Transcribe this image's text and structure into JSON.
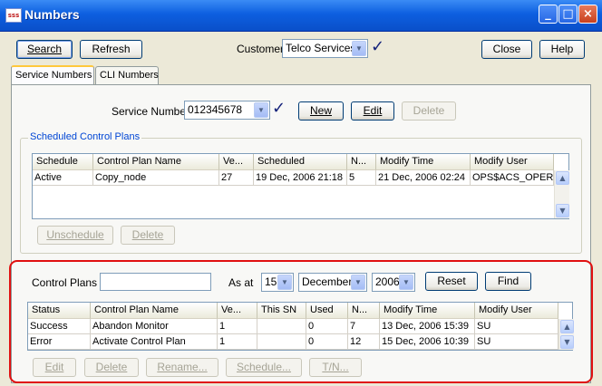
{
  "window": {
    "title": "Numbers",
    "app_icon": "sss",
    "minimize": "_",
    "maximize": "□",
    "close": "×"
  },
  "toolbar": {
    "search": "Search",
    "refresh": "Refresh",
    "customer_label": "Customer",
    "customer_value": "Telco Services",
    "close": "Close",
    "help": "Help"
  },
  "tabs": [
    {
      "label": "Service Numbers"
    },
    {
      "label": "CLI Numbers"
    }
  ],
  "service": {
    "label": "Service Number",
    "value": "012345678",
    "new": "New",
    "edit": "Edit",
    "delete": "Delete"
  },
  "scheduled": {
    "title": "Scheduled Control Plans",
    "columns": [
      "Schedule",
      "Control Plan Name",
      "Ve...",
      "Scheduled",
      "N...",
      "Modify Time",
      "Modify User"
    ],
    "rows": [
      [
        "Active",
        "Copy_node",
        "27",
        "19 Dec, 2006 21:18",
        "5",
        "21 Dec, 2006 02:24",
        "OPS$ACS_OPER"
      ]
    ],
    "unschedule": "Unschedule",
    "delete": "Delete"
  },
  "plans": {
    "label": "Control Plans",
    "filter_value": "",
    "as_at_label": "As at",
    "day": "15",
    "month": "December",
    "year": "2006",
    "reset": "Reset",
    "find": "Find",
    "columns": [
      "Status",
      "Control Plan Name",
      "Ve...",
      "This SN",
      "Used",
      "N...",
      "Modify Time",
      "Modify User"
    ],
    "rows": [
      [
        "Success",
        "Abandon Monitor",
        "1",
        "",
        "0",
        "7",
        "13 Dec, 2006 15:39",
        "SU"
      ],
      [
        "Error",
        "Activate Control Plan",
        "1",
        "",
        "0",
        "12",
        "15 Dec, 2006 10:39",
        "SU"
      ]
    ],
    "edit": "Edit",
    "delete": "Delete",
    "rename": "Rename...",
    "schedule": "Schedule...",
    "tn": "T/N..."
  },
  "icons": {
    "dropdown": "▼",
    "scroll_up": "▲",
    "scroll_down": "▼",
    "checkmark": "✓"
  },
  "colors": {
    "title_bar": "#0d5fe0",
    "group_title": "#0046d5",
    "highlight": "#e01010",
    "checkmark": "#14227a"
  }
}
